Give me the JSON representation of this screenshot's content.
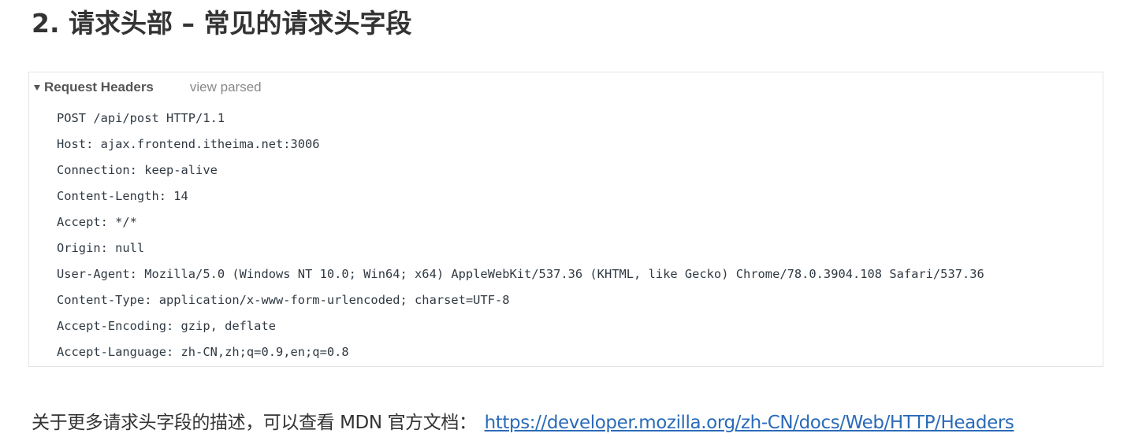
{
  "page_title": "2. 请求头部 – 常见的请求头字段",
  "request_headers": {
    "title": "Request Headers",
    "view_parsed_label": "view parsed",
    "lines": [
      "POST /api/post HTTP/1.1",
      "Host: ajax.frontend.itheima.net:3006",
      "Connection: keep-alive",
      "Content-Length: 14",
      "Accept: */*",
      "Origin: null",
      "User-Agent: Mozilla/5.0 (Windows NT 10.0; Win64; x64) AppleWebKit/537.36 (KHTML, like Gecko) Chrome/78.0.3904.108 Safari/537.36",
      "Content-Type: application/x-www-form-urlencoded; charset=UTF-8",
      "Accept-Encoding: gzip, deflate",
      "Accept-Language: zh-CN,zh;q=0.9,en;q=0.8"
    ]
  },
  "footer": {
    "text": "关于更多请求头字段的描述，可以查看 MDN 官方文档：",
    "link_text": "https://developer.mozilla.org/zh-CN/docs/Web/HTTP/Headers"
  }
}
